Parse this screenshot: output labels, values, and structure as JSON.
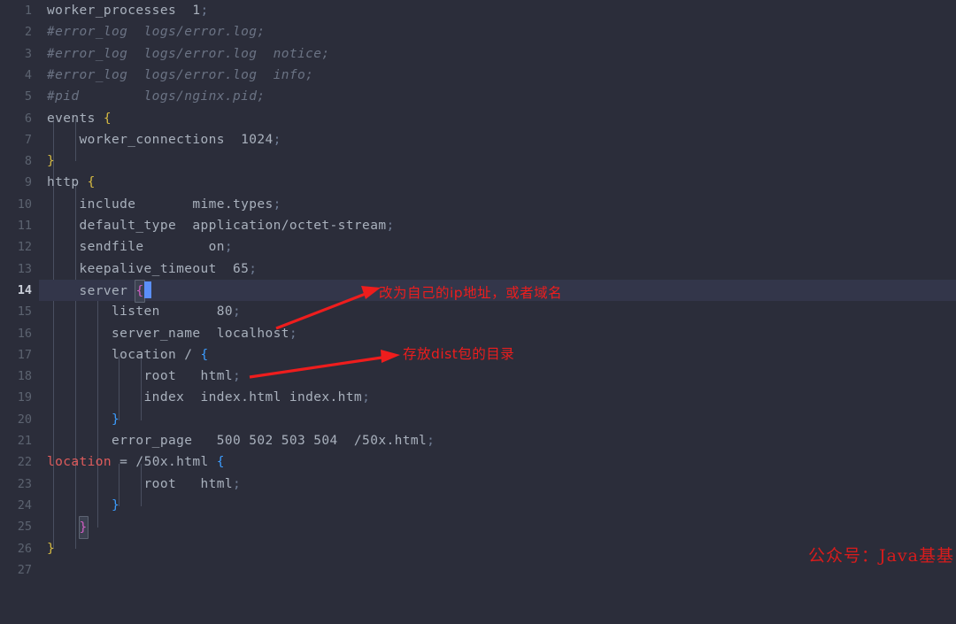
{
  "editor": {
    "theme_background": "#2b2d3a",
    "active_line_number": 14,
    "total_lines": 27,
    "filename_language": "nginx",
    "colors": {
      "background": "#2b2d3a",
      "text": "#a9b1bd",
      "comment": "#6b7384",
      "brace_level1": "#d5b942",
      "brace_level2": "#3c9dff",
      "brace_level3": "#d05ec4",
      "error": "#e05c5c",
      "line_number": "#5c6370",
      "caret": "#5b8ff9",
      "annotation_red": "#ee1d1d"
    }
  },
  "lines": [
    {
      "n": "1",
      "text": "worker_processes  1;"
    },
    {
      "n": "2",
      "text": "#error_log  logs/error.log;"
    },
    {
      "n": "3",
      "text": "#error_log  logs/error.log  notice;"
    },
    {
      "n": "4",
      "text": "#error_log  logs/error.log  info;"
    },
    {
      "n": "5",
      "text": "#pid        logs/nginx.pid;"
    },
    {
      "n": "6",
      "text": "events {"
    },
    {
      "n": "7",
      "text": "    worker_connections  1024;"
    },
    {
      "n": "8",
      "text": "}"
    },
    {
      "n": "9",
      "text": "http {"
    },
    {
      "n": "10",
      "text": "    include       mime.types;"
    },
    {
      "n": "11",
      "text": "    default_type  application/octet-stream;"
    },
    {
      "n": "12",
      "text": "    sendfile        on;"
    },
    {
      "n": "13",
      "text": "    keepalive_timeout  65;"
    },
    {
      "n": "14",
      "text": "    server {"
    },
    {
      "n": "15",
      "text": "        listen       80;"
    },
    {
      "n": "16",
      "text": "        server_name  localhost;"
    },
    {
      "n": "17",
      "text": "        location / {"
    },
    {
      "n": "18",
      "text": "            root   html;"
    },
    {
      "n": "19",
      "text": "            index  index.html index.htm;"
    },
    {
      "n": "20",
      "text": "        }"
    },
    {
      "n": "21",
      "text": "        error_page   500 502 503 504  /50x.html;"
    },
    {
      "n": "22",
      "text": "        location = /50x.html {"
    },
    {
      "n": "23",
      "text": "            root   html;"
    },
    {
      "n": "24",
      "text": "        }"
    },
    {
      "n": "25",
      "text": "    }"
    },
    {
      "n": "26",
      "text": "}"
    },
    {
      "n": "27",
      "text": ""
    }
  ],
  "annotations": [
    {
      "id": "ip-note",
      "text": "改为自己的ip地址，或者域名"
    },
    {
      "id": "dist-note",
      "text": "存放dist包的目录"
    }
  ],
  "watermark": {
    "text": "公众号：Java基基"
  }
}
